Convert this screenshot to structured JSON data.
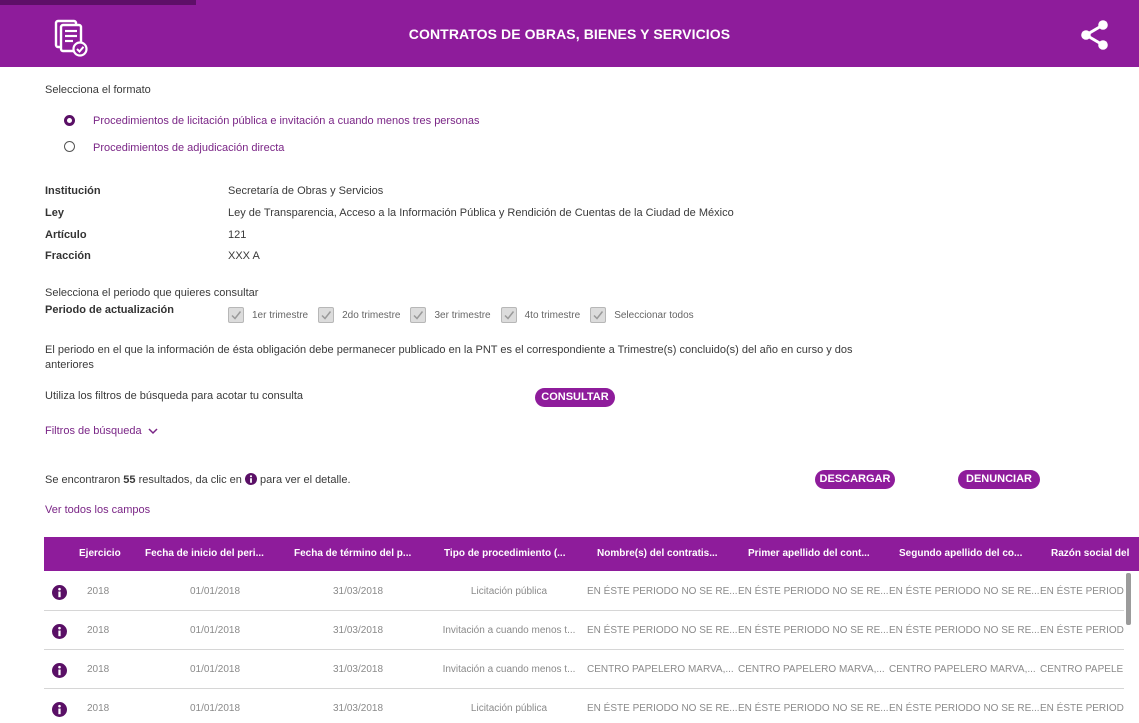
{
  "header": {
    "title": "CONTRATOS DE OBRAS, BIENES Y SERVICIOS",
    "doc_icon": "document-check-icon",
    "share_icon": "share-icon"
  },
  "format": {
    "label": "Selecciona el formato",
    "options": [
      {
        "label": "Procedimientos de licitación pública e invitación a cuando menos tres personas",
        "selected": true
      },
      {
        "label": "Procedimientos de adjudicación directa",
        "selected": false
      }
    ]
  },
  "info": {
    "institucion_label": "Institución",
    "institucion_value": "Secretaría de Obras y Servicios",
    "ley_label": "Ley",
    "ley_value": "Ley de Transparencia, Acceso a la Información Pública y Rendición de Cuentas de la Ciudad de México",
    "articulo_label": "Artículo",
    "articulo_value": "121",
    "fraccion_label": "Fracción",
    "fraccion_value": "XXX A"
  },
  "periodo": {
    "prompt": "Selecciona el periodo que quieres consultar",
    "label": "Periodo de actualización",
    "options": [
      "1er trimestre",
      "2do trimestre",
      "3er trimestre",
      "4to trimestre",
      "Seleccionar todos"
    ],
    "note_line1": "El periodo en el que la información de ésta obligación debe permanecer publicado en la PNT es el correspondiente a Trimestre(s) concluido(s) del año en curso y dos",
    "note_line2": "anteriores"
  },
  "filters": {
    "hint": "Utiliza los filtros de búsqueda para acotar tu consulta",
    "consultar_label": "CONSULTAR",
    "toggle_label": "Filtros de búsqueda"
  },
  "results": {
    "prefix": "Se encontraron ",
    "count": "55",
    "suffix_before_icon": " resultados, da clic en ",
    "suffix_after_icon": " para ver el detalle.",
    "descargar_label": "DESCARGAR",
    "denunciar_label": "DENUNCIAR",
    "ver_campos_label": "Ver todos los campos"
  },
  "table": {
    "columns": [
      "Ejercicio",
      "Fecha de inicio del peri...",
      "Fecha de término del p...",
      "Tipo de procedimiento (...",
      "Nombre(s) del contratis...",
      "Primer apellido del cont...",
      "Segundo apellido del co...",
      "Razón social del"
    ],
    "rows": [
      [
        "2018",
        "01/01/2018",
        "31/03/2018",
        "Licitación pública",
        "EN ÉSTE PERIODO NO SE RE...",
        "EN ÉSTE PERIODO NO SE RE...",
        "EN ÉSTE PERIODO NO SE RE...",
        "EN ÉSTE PERIODO"
      ],
      [
        "2018",
        "01/01/2018",
        "31/03/2018",
        "Invitación a cuando menos t...",
        "EN ÉSTE PERIODO NO SE RE...",
        "EN ÉSTE PERIODO NO SE RE...",
        "EN ÉSTE PERIODO NO SE RE...",
        "EN ÉSTE PERIODO"
      ],
      [
        "2018",
        "01/01/2018",
        "31/03/2018",
        "Invitación a cuando menos t...",
        "CENTRO PAPELERO MARVA,...",
        "CENTRO PAPELERO MARVA,...",
        "CENTRO PAPELERO MARVA,...",
        "CENTRO PAPELEI"
      ],
      [
        "2018",
        "01/01/2018",
        "31/03/2018",
        "Licitación pública",
        "EN ÉSTE PERIODO NO SE RE...",
        "EN ÉSTE PERIODO NO SE RE...",
        "EN ÉSTE PERIODO NO SE RE...",
        "EN ÉSTE PERIODO"
      ]
    ]
  },
  "colors": {
    "brand": "#8e1c9b",
    "brand_dark": "#5e0f68",
    "link": "#7a2586"
  }
}
